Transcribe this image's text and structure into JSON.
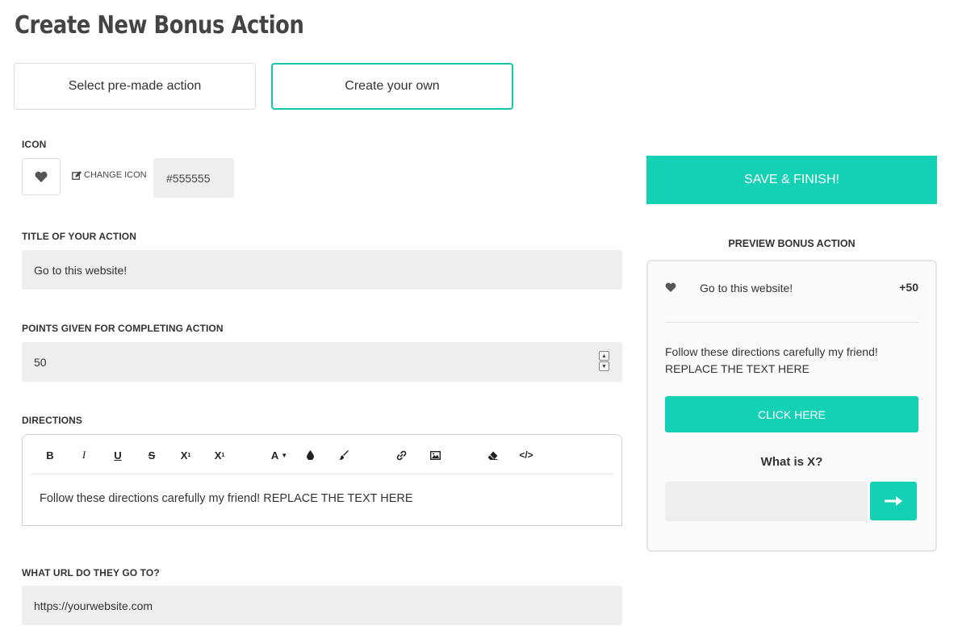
{
  "page": {
    "title": "Create New Bonus Action"
  },
  "tabs": {
    "premade_label": "Select pre-made action",
    "own_label": "Create your own"
  },
  "icon_section": {
    "label": "ICON",
    "icon": "heart-icon",
    "change_label": "CHANGE ICON",
    "color_value": "#555555"
  },
  "title_section": {
    "label": "TITLE OF YOUR ACTION",
    "value": "Go to this website!"
  },
  "points_section": {
    "label": "POINTS GIVEN FOR COMPLETING ACTION",
    "value": "50"
  },
  "directions_section": {
    "label": "DIRECTIONS",
    "toolbar": {
      "bold": "B",
      "italic": "I",
      "underline": "U",
      "strike": "S",
      "subscript": "X",
      "superscript": "X",
      "font_color": "A"
    },
    "content": "Follow these directions carefully my friend! REPLACE THE TEXT HERE"
  },
  "url_section": {
    "label": "WHAT URL DO THEY GO TO?",
    "value": "https://yourwebsite.com"
  },
  "save_button": {
    "label": "SAVE & FINISH!"
  },
  "preview": {
    "title": "PREVIEW BONUS ACTION",
    "action_name": "Go to this website!",
    "points": "+50",
    "directions_line1": "Follow these directions carefully my friend!",
    "directions_line2": "REPLACE THE TEXT HERE",
    "click_label": "CLICK HERE",
    "question": "What is X?"
  },
  "colors": {
    "accent": "#14d0b4",
    "field_bg": "#eeeeee",
    "icon_color": "#555555"
  }
}
